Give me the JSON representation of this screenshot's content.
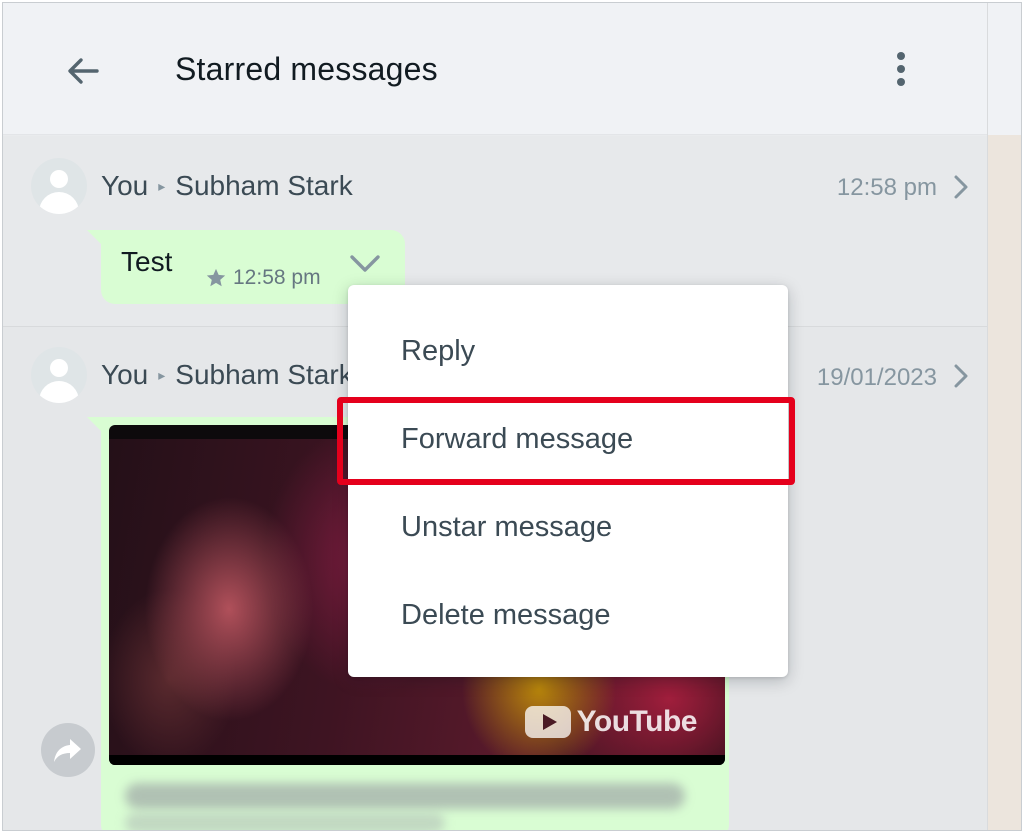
{
  "header": {
    "title": "Starred messages",
    "back_icon": "arrow-left-icon",
    "menu_icon": "kebab-menu-icon"
  },
  "messages": [
    {
      "sender": "You",
      "recipient": "Subham Stark",
      "timestamp": "12:58 pm",
      "text": "Test",
      "bubble_time": "12:58 pm"
    },
    {
      "sender": "You",
      "recipient": "Subham Stark",
      "timestamp": "19/01/2023",
      "media_watermark": "YouTube"
    }
  ],
  "context_menu": {
    "items": [
      "Reply",
      "Forward message",
      "Unstar message",
      "Delete message"
    ],
    "highlighted_item": "Forward message"
  },
  "colors": {
    "bubble_outgoing": "#d9fdd3",
    "highlight_border": "#e5001c",
    "header_bg": "#f0f2f5"
  }
}
